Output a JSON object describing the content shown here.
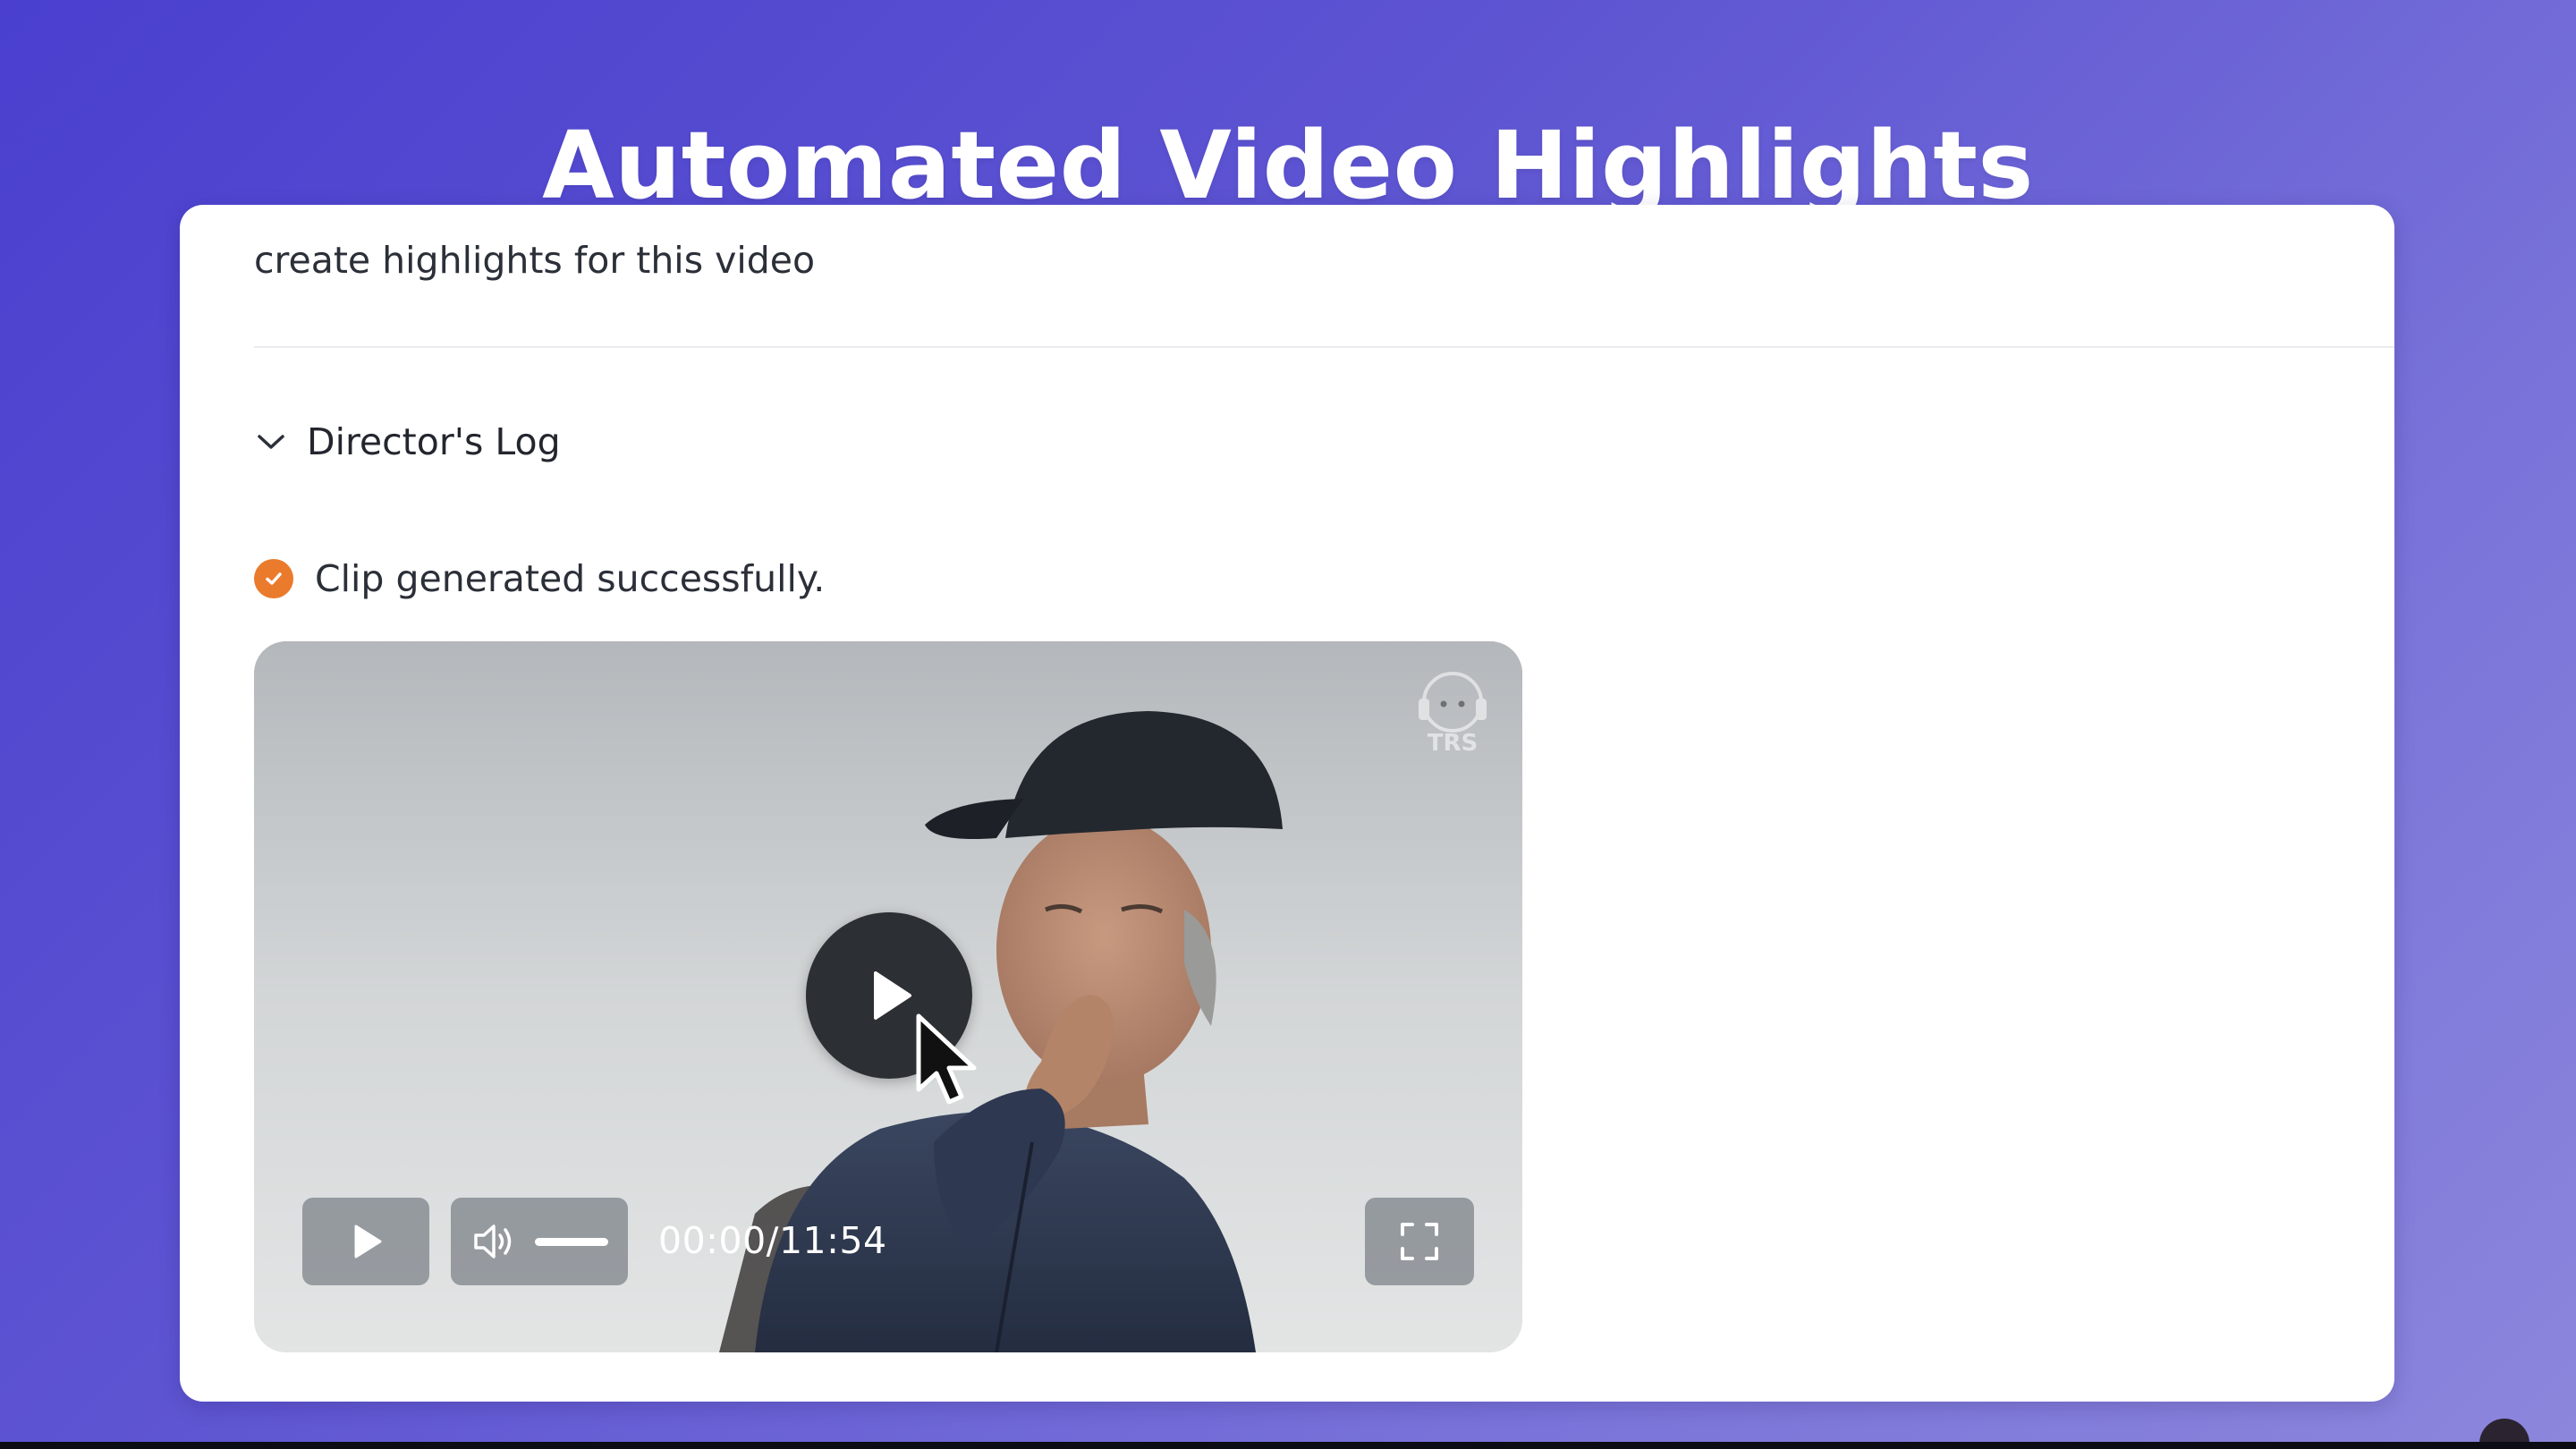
{
  "page": {
    "title": "Automated Video Highlights"
  },
  "chat": {
    "prompt": "create highlights for this video",
    "log_label": "Director's Log",
    "status_text": "Clip generated successfully."
  },
  "player": {
    "time": "00:00/11:54",
    "watermark_text": "TRS",
    "progress_fraction": 0.0,
    "accent_color": "#e4473b"
  },
  "icons": {
    "chevron": "chevron-down-icon",
    "status": "check-circle-icon",
    "big_play": "play-icon",
    "play": "play-icon",
    "volume": "volume-icon",
    "fullscreen": "fullscreen-icon",
    "cursor": "mouse-cursor-icon"
  },
  "colors": {
    "status_check": "#ea7a2c",
    "background_gradient_start": "#4a3fcf",
    "background_gradient_end": "#8c86dc"
  }
}
